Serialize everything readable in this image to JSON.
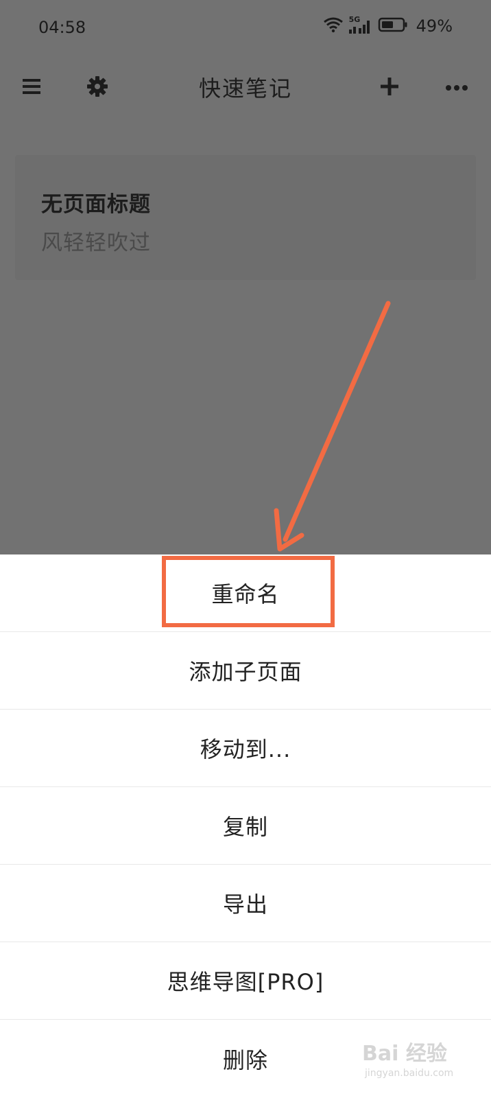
{
  "status_bar": {
    "time": "04:58",
    "network": "5G",
    "battery": "49%"
  },
  "app_bar": {
    "title": "快速笔记",
    "icons": [
      "menu-icon",
      "gear-icon",
      "plus-icon",
      "more-icon"
    ]
  },
  "note": {
    "title": "无页面标题",
    "preview": "风轻轻吹过"
  },
  "menu": {
    "items": [
      {
        "label": "重命名"
      },
      {
        "label": "添加子页面"
      },
      {
        "label": "移动到..."
      },
      {
        "label": "复制"
      },
      {
        "label": "导出"
      },
      {
        "label": "思维导图[PRO]"
      },
      {
        "label": "删除"
      }
    ]
  },
  "colors": {
    "scrim": "#727272",
    "sheet": "#ffffff",
    "accent": "#f26b43",
    "text": "#222222"
  },
  "watermark": {
    "main": "Bai 经验",
    "sub": "jingyan.baidu.com"
  }
}
